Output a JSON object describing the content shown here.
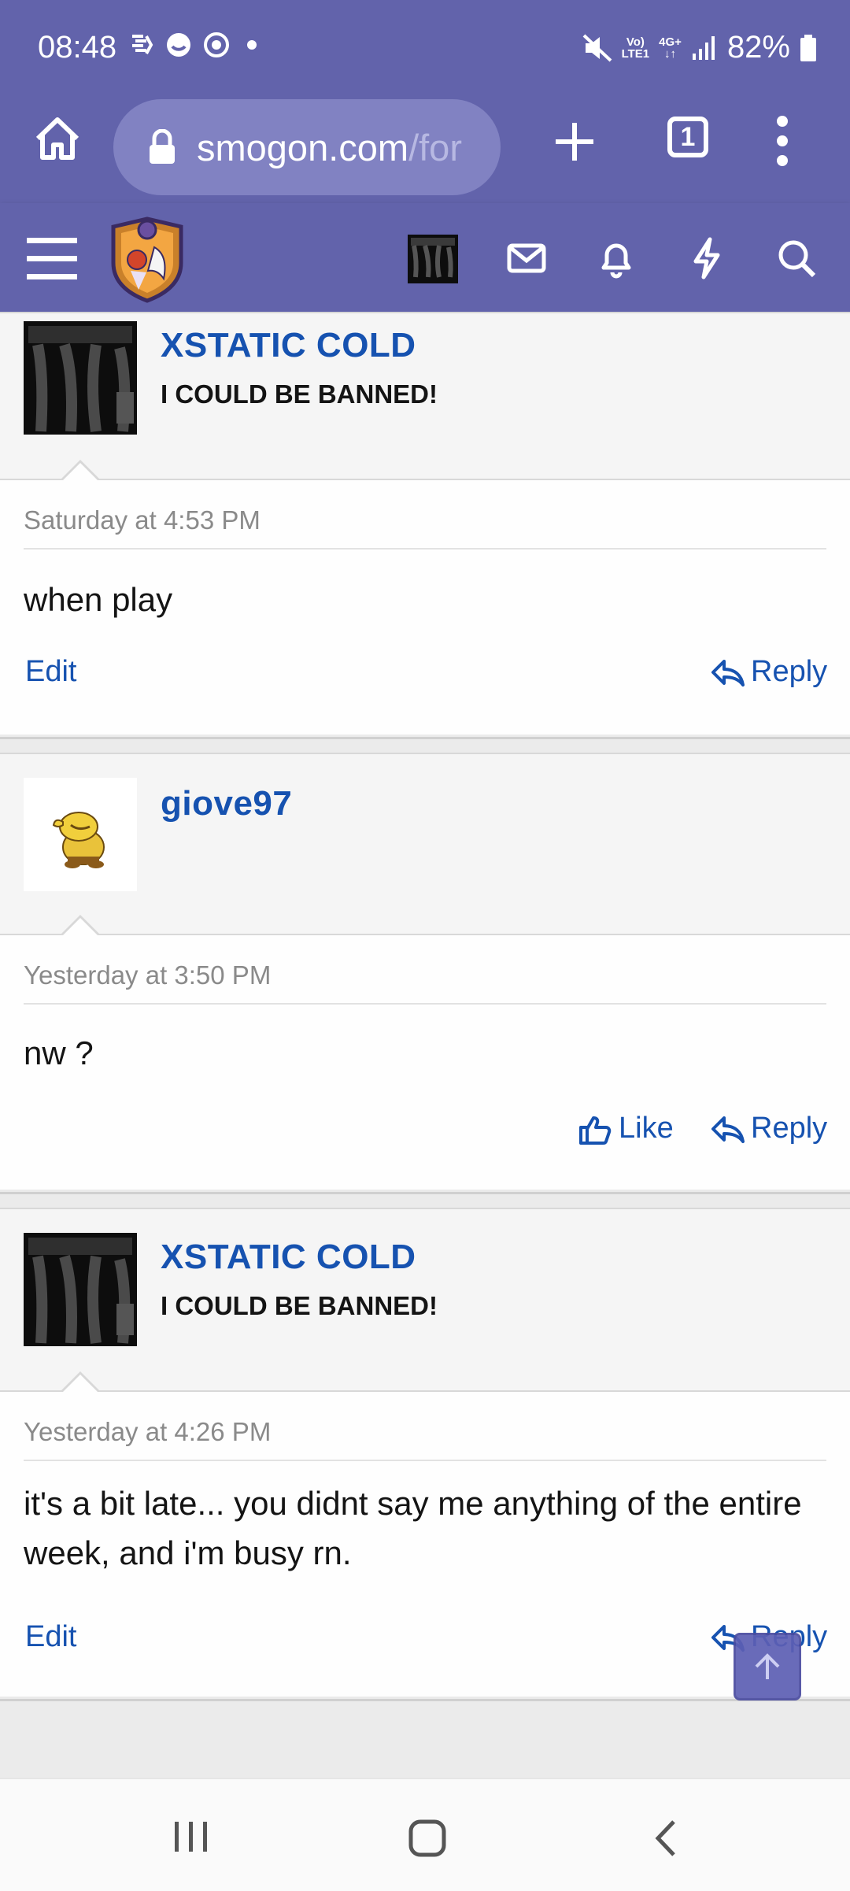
{
  "status_bar": {
    "time": "08:48",
    "net_top": "Vo)",
    "net_bottom": "LTE1",
    "gen_top": "4G+",
    "gen_bottom": "↓↑",
    "battery_text": "82%"
  },
  "browser": {
    "url_main": "smogon.com",
    "url_path": "/for",
    "tab_count": "1"
  },
  "posts": [
    {
      "username": "XSTATIC COLD",
      "user_title": "I COULD BE BANNED!",
      "date": "Saturday at 4:53 PM",
      "text": "when play",
      "left_action": "Edit",
      "reply": "Reply"
    },
    {
      "username": "giove97",
      "user_title": "",
      "date": "Yesterday at 3:50 PM",
      "text": "nw ?",
      "like": "Like",
      "reply": "Reply"
    },
    {
      "username": "XSTATIC COLD",
      "user_title": "I COULD BE BANNED!",
      "date": "Yesterday at 4:26 PM",
      "text": "it's a bit late... you didnt say me anything of the entire week, and i'm busy rn.",
      "left_action": "Edit",
      "reply": "Reply"
    }
  ],
  "colors": {
    "brand": "#6263ab",
    "link": "#1652b0"
  }
}
